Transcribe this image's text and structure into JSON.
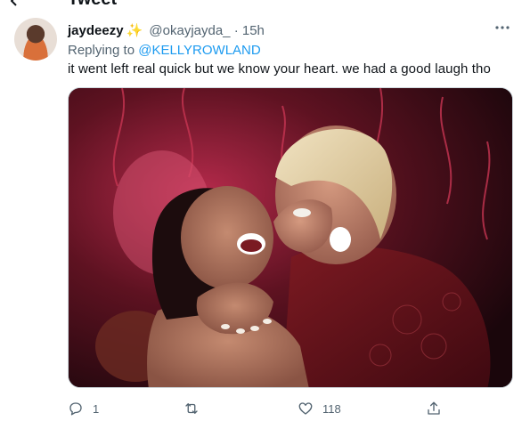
{
  "page": {
    "title": "Tweet"
  },
  "tweet": {
    "author": {
      "display_name": "jaydeezy",
      "badge_emoji": "✨",
      "handle": "@okayjayda_",
      "separator": "·",
      "time": "15h"
    },
    "replying_to": {
      "prefix": "Replying to ",
      "mention": "@KELLYROWLAND"
    },
    "text": "it went left real quick but we know your heart. we had a good laugh tho",
    "media": {
      "type": "photo",
      "icon": "photo"
    },
    "actions": {
      "reply": {
        "icon": "reply-icon",
        "count": "1"
      },
      "retweet": {
        "icon": "retweet-icon",
        "count": ""
      },
      "like": {
        "icon": "heart-icon",
        "count": "118"
      },
      "share": {
        "icon": "share-icon",
        "count": ""
      }
    }
  },
  "colors": {
    "link": "#1d9bf0",
    "muted": "#536471",
    "text": "#0f1419",
    "sparkle": "#f4b400"
  }
}
